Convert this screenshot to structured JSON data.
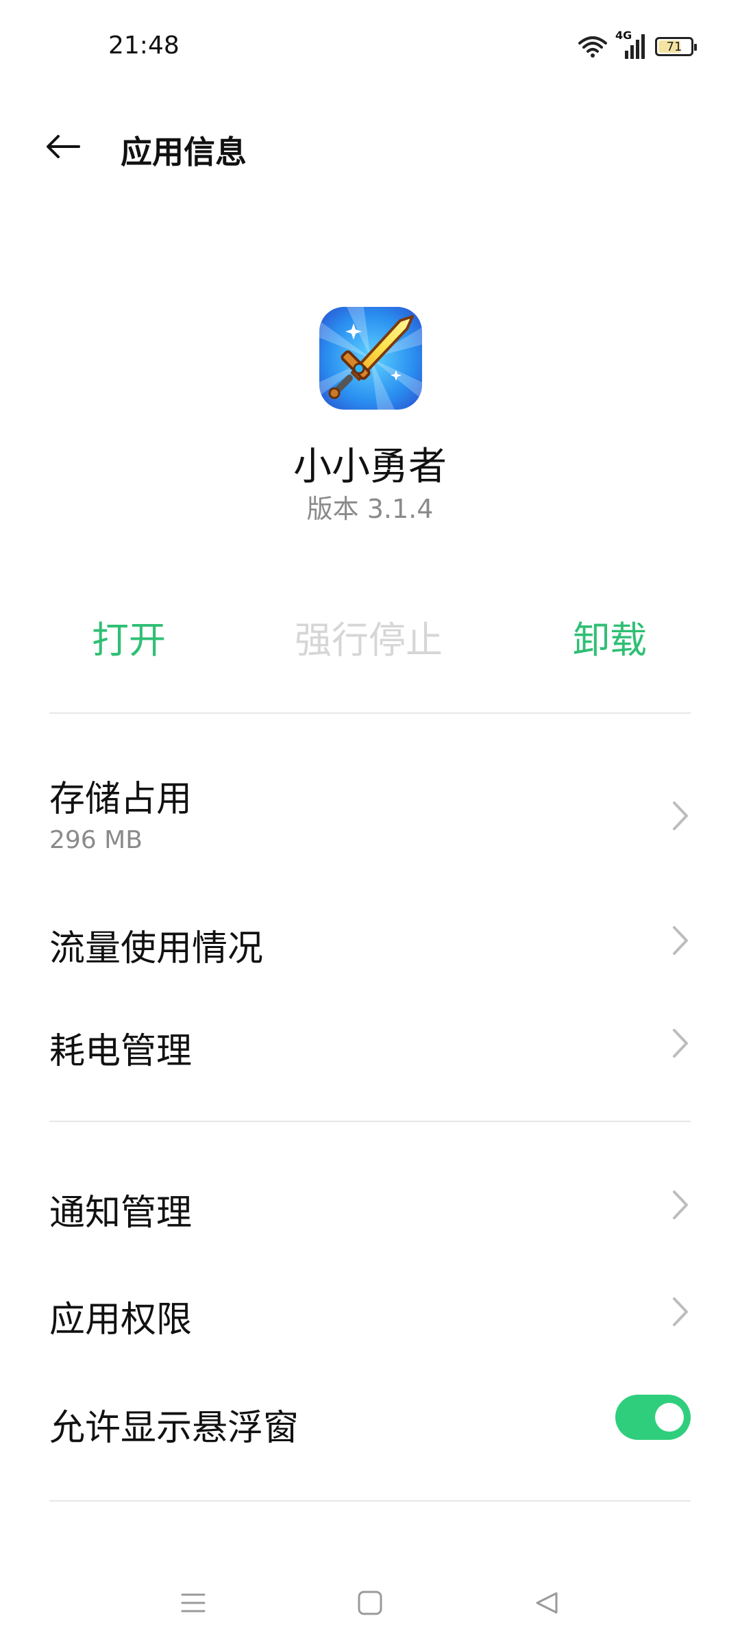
{
  "status_bar": {
    "time": "21:48",
    "network_label": "4G",
    "battery": "71",
    "battery_level": 0.71,
    "icons": [
      "wifi-icon",
      "signal-icon",
      "battery-icon"
    ]
  },
  "header": {
    "title": "应用信息",
    "back_icon": "arrow-left-icon"
  },
  "app": {
    "name": "小小勇者",
    "version": "版本 3.1.4",
    "icon": "sword-app-icon"
  },
  "actions": {
    "open": "打开",
    "force_stop": "强行停止",
    "uninstall": "卸载"
  },
  "settings": {
    "storage": {
      "label": "存储占用",
      "value": "296 MB"
    },
    "data_usage": {
      "label": "流量使用情况"
    },
    "power": {
      "label": "耗电管理"
    },
    "notifications": {
      "label": "通知管理"
    },
    "permissions": {
      "label": "应用权限"
    },
    "floating_window": {
      "label": "允许显示悬浮窗",
      "enabled": true
    }
  },
  "colors": {
    "accent": "#2fbf74",
    "disabled": "#d6d6d6",
    "toggle_on": "#2fce7d"
  },
  "nav_bar": {
    "icons": [
      "menu-icon",
      "home-icon",
      "back-triangle-icon"
    ]
  }
}
